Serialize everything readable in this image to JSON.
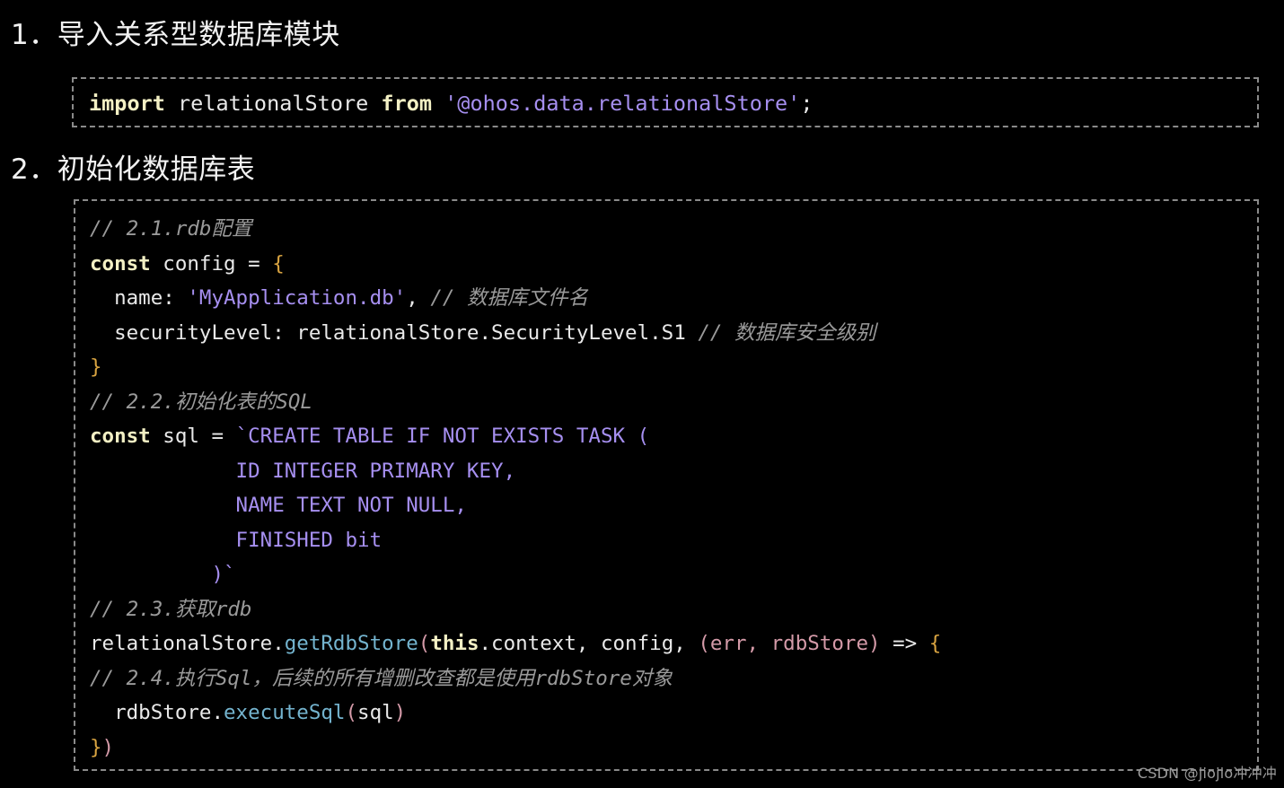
{
  "sections": [
    {
      "number": "1．",
      "title": "导入关系型数据库模块"
    },
    {
      "number": "2．",
      "title": "初始化数据库表"
    }
  ],
  "import_box": {
    "keyword_import": "import",
    "module_name": " relationalStore ",
    "keyword_from": "from",
    "string_literal": " '@ohos.data.relationalStore'",
    "semicolon": ";"
  },
  "init_box": {
    "line01_comment": "// 2.1.rdb配置",
    "line02_const": "const",
    "line02_rest": " config = ",
    "line02_brace": "{",
    "line03_key": "  name: ",
    "line03_str": "'MyApplication.db'",
    "line03_comma": ", ",
    "line03_comment": "// 数据库文件名",
    "line04_text": "  securityLevel: relationalStore.SecurityLevel.S1 ",
    "line04_comment": "// 数据库安全级别",
    "line05_brace": "}",
    "line06_comment": "// 2.2.初始化表的SQL",
    "line07_const": "const",
    "line07_mid": " sql = ",
    "line07_tmpl": "`CREATE TABLE IF NOT EXISTS TASK (",
    "line08_tmpl": "            ID INTEGER PRIMARY KEY,",
    "line09_tmpl": "            NAME TEXT NOT NULL,",
    "line10_tmpl": "            FINISHED bit",
    "line11_tmpl": "          )`",
    "line12_comment": "// 2.3.获取rdb",
    "line13_obj": "relationalStore.",
    "line13_fn": "getRdbStore",
    "line13_paren_open": "(",
    "line13_this": "this",
    "line13_args": ".context, config, ",
    "line13_paren2": "(err, rdbStore)",
    "line13_arrow": " => ",
    "line13_brace": "{",
    "line14_comment": "// 2.4.执行Sql，后续的所有增删改查都是使用rdbStore对象",
    "line15_obj": "  rdbStore.",
    "line15_fn": "executeSql",
    "line15_paren_open": "(",
    "line15_arg": "sql",
    "line15_paren_close": ")",
    "line16_brace": "}",
    "line16_paren": ")"
  },
  "watermark": "CSDN @jiojio冲冲冲",
  "colors": {
    "background": "#000000",
    "heading_text": "#f2f2f2",
    "code_plain": "#e6e6e6",
    "keyword": "#f3f0c4",
    "string": "#a68ff0",
    "comment": "#9a9a9a",
    "brace": "#d9a441",
    "paren": "#d49aa8",
    "function": "#74b4cf",
    "dashed_border": "#8a8a8a",
    "watermark": "#9b9b9b"
  }
}
